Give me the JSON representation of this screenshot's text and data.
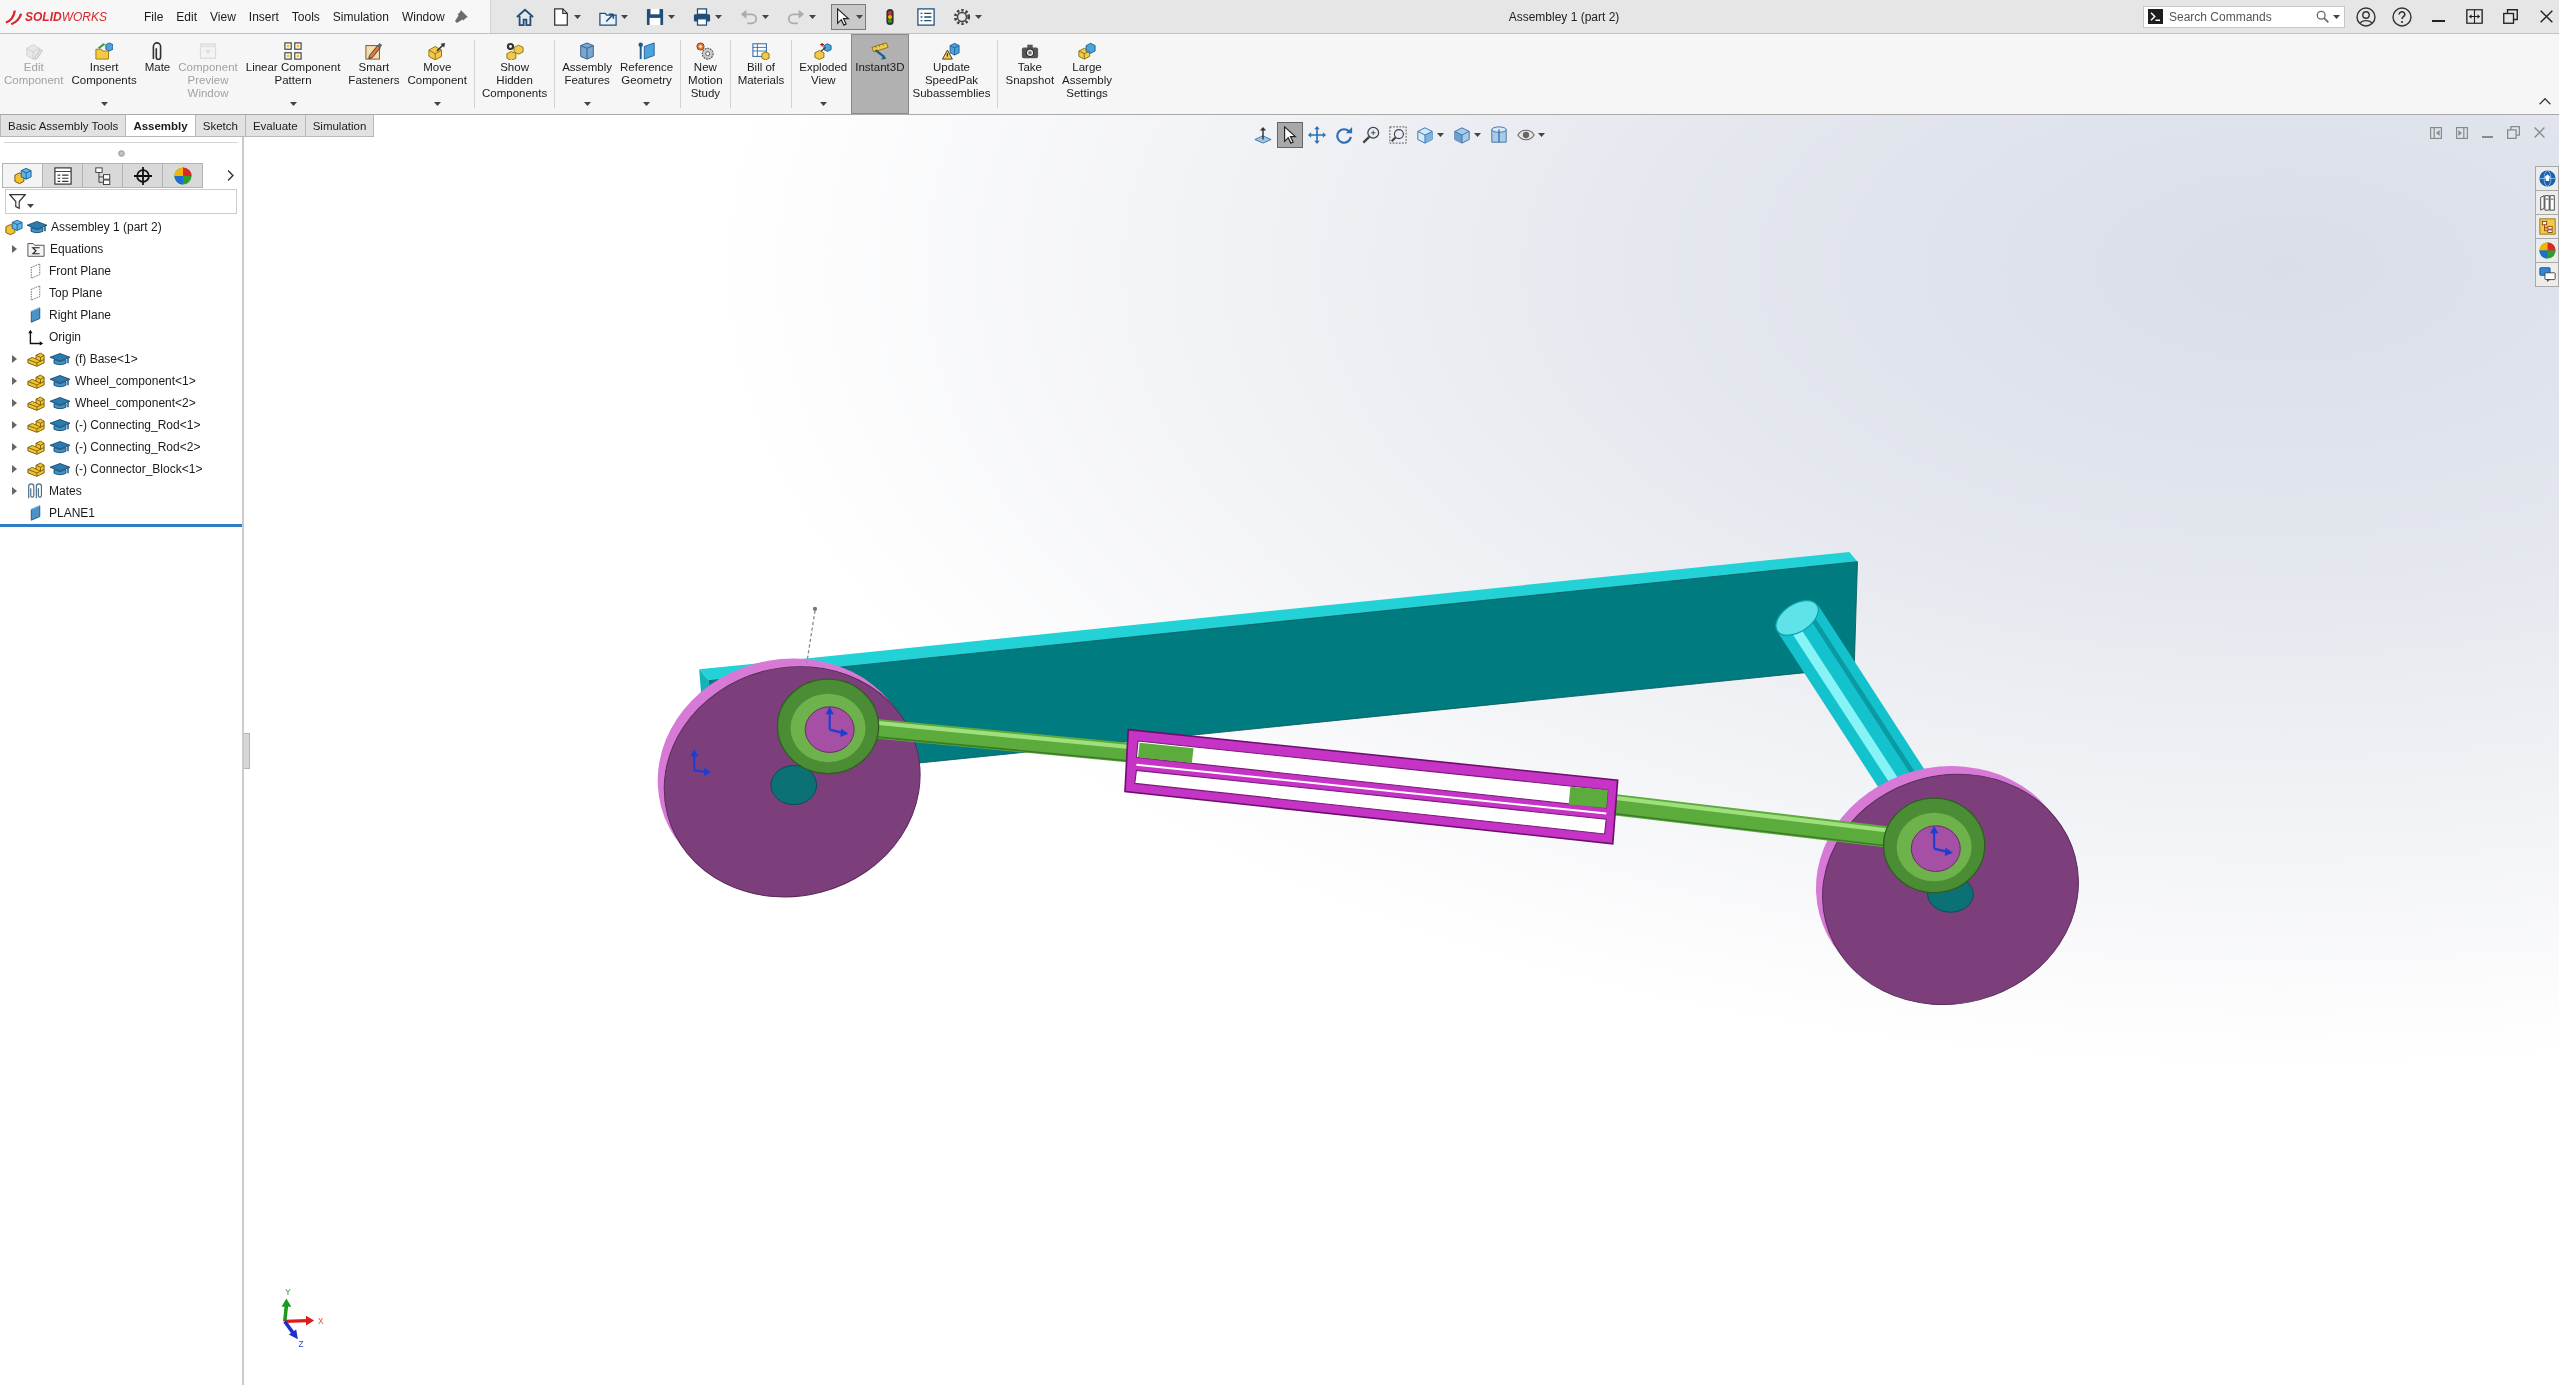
{
  "app": {
    "logo": "**SOLID**WORKS",
    "menus": [
      "File",
      "Edit",
      "View",
      "Insert",
      "Tools",
      "Simulation",
      "Window"
    ],
    "title": "Assembley 1 (part 2)"
  },
  "quick_access": [
    {
      "kind": "home",
      "dropdown": false,
      "disabled": false,
      "selected": false
    },
    {
      "kind": "new",
      "dropdown": true,
      "disabled": false,
      "selected": false
    },
    {
      "kind": "open",
      "dropdown": true,
      "disabled": false,
      "selected": false
    },
    {
      "kind": "save",
      "dropdown": true,
      "disabled": false,
      "selected": false
    },
    {
      "kind": "print",
      "dropdown": true,
      "disabled": false,
      "selected": false
    },
    {
      "kind": "undo",
      "dropdown": true,
      "disabled": true,
      "selected": false
    },
    {
      "kind": "redo",
      "dropdown": true,
      "disabled": true,
      "selected": false
    },
    {
      "kind": "select",
      "dropdown": true,
      "disabled": false,
      "selected": true
    },
    {
      "kind": "rebuild",
      "dropdown": false,
      "disabled": false,
      "selected": false
    },
    {
      "kind": "properties",
      "dropdown": false,
      "disabled": false,
      "selected": false
    },
    {
      "kind": "options",
      "dropdown": true,
      "disabled": false,
      "selected": false
    }
  ],
  "search": {
    "placeholder": "Search Commands"
  },
  "command_manager": {
    "groups": [
      [
        {
          "label": "Edit\nComponent",
          "kind": "edit",
          "disabled": true,
          "selected": false,
          "dropdown": false
        },
        {
          "label": "Insert\nComponents",
          "kind": "insert",
          "disabled": false,
          "selected": false,
          "dropdown": true
        },
        {
          "label": "Mate",
          "kind": "mate",
          "disabled": false,
          "selected": false,
          "dropdown": false
        },
        {
          "label": "Component\nPreview\nWindow",
          "kind": "preview",
          "disabled": true,
          "selected": false,
          "dropdown": false
        },
        {
          "label": "Linear Component\nPattern",
          "kind": "pattern",
          "disabled": false,
          "selected": false,
          "dropdown": true
        },
        {
          "label": "Smart\nFasteners",
          "kind": "fasteners",
          "disabled": false,
          "selected": false,
          "dropdown": false
        },
        {
          "label": "Move\nComponent",
          "kind": "move",
          "disabled": false,
          "selected": false,
          "dropdown": true
        }
      ],
      [
        {
          "label": "Show\nHidden\nComponents",
          "kind": "show",
          "disabled": false,
          "selected": false,
          "dropdown": false
        }
      ],
      [
        {
          "label": "Assembly\nFeatures",
          "kind": "features",
          "disabled": false,
          "selected": false,
          "dropdown": true
        },
        {
          "label": "Reference\nGeometry",
          "kind": "reference",
          "disabled": false,
          "selected": false,
          "dropdown": true
        }
      ],
      [
        {
          "label": "New\nMotion\nStudy",
          "kind": "motion",
          "disabled": false,
          "selected": false,
          "dropdown": false
        }
      ],
      [
        {
          "label": "Bill of\nMaterials",
          "kind": "bom",
          "disabled": false,
          "selected": false,
          "dropdown": false
        }
      ],
      [
        {
          "label": "Exploded\nView",
          "kind": "explode",
          "disabled": false,
          "selected": false,
          "dropdown": true
        },
        {
          "label": "Instant3D",
          "kind": "instant3d",
          "disabled": false,
          "selected": true,
          "dropdown": false
        },
        {
          "label": "Update\nSpeedPak\nSubassemblies",
          "kind": "speedpak",
          "disabled": false,
          "selected": false,
          "dropdown": false
        }
      ],
      [
        {
          "label": "Take\nSnapshot",
          "kind": "snapshot",
          "disabled": false,
          "selected": false,
          "dropdown": false
        },
        {
          "label": "Large\nAssembly\nSettings",
          "kind": "settings",
          "disabled": false,
          "selected": false,
          "dropdown": false
        }
      ]
    ],
    "tabs": [
      {
        "label": "Basic Assembly Tools",
        "selected": false
      },
      {
        "label": "Assembly",
        "selected": true
      },
      {
        "label": "Sketch",
        "selected": false
      },
      {
        "label": "Evaluate",
        "selected": false
      },
      {
        "label": "Simulation",
        "selected": false
      }
    ]
  },
  "feature_tree": {
    "tabs": [
      {
        "kind": "features",
        "selected": true
      },
      {
        "kind": "properties",
        "selected": false
      },
      {
        "kind": "configurations",
        "selected": false
      },
      {
        "kind": "dimxpert",
        "selected": false
      },
      {
        "kind": "display",
        "selected": false
      }
    ],
    "root": {
      "label": "Assembley 1 (part 2)",
      "kind": "assembly",
      "children": [
        {
          "label": "Equations",
          "kind": "equations",
          "expanded": false
        },
        {
          "label": "Front Plane",
          "kind": "plane",
          "shown": false
        },
        {
          "label": "Top Plane",
          "kind": "plane",
          "shown": false
        },
        {
          "label": "Right Plane",
          "kind": "plane",
          "shown": true
        },
        {
          "label": "Origin",
          "kind": "origin"
        },
        {
          "label": "(f) Base<1>",
          "kind": "component",
          "expanded": false
        },
        {
          "label": "Wheel_component<1>",
          "kind": "component",
          "expanded": false
        },
        {
          "label": "Wheel_component<2>",
          "kind": "component",
          "expanded": false
        },
        {
          "label": "(-) Connecting_Rod<1>",
          "kind": "component",
          "expanded": false
        },
        {
          "label": "(-) Connecting_Rod<2>",
          "kind": "component",
          "expanded": false
        },
        {
          "label": "(-) Connector_Block<1>",
          "kind": "component",
          "expanded": false
        },
        {
          "label": "Mates",
          "kind": "mates",
          "expanded": false
        },
        {
          "label": "PLANE1",
          "kind": "plane",
          "shown": true
        }
      ]
    }
  },
  "viewport": {
    "view_tools": [
      {
        "kind": "normal",
        "selected": false,
        "dropdown": false
      },
      {
        "kind": "select",
        "selected": true,
        "dropdown": false
      },
      {
        "kind": "pan",
        "selected": false,
        "dropdown": false
      },
      {
        "kind": "rotate",
        "selected": false,
        "dropdown": false
      },
      {
        "kind": "zoomfit",
        "selected": false,
        "dropdown": false
      },
      {
        "kind": "zoomarea",
        "selected": false,
        "dropdown": false
      },
      {
        "kind": "orientation",
        "selected": false,
        "dropdown": true
      },
      {
        "kind": "display",
        "selected": false,
        "dropdown": true
      },
      {
        "kind": "section",
        "selected": false,
        "dropdown": false
      },
      {
        "kind": "hide",
        "selected": false,
        "dropdown": true
      }
    ],
    "task_pane": [
      {
        "kind": "resources"
      },
      {
        "kind": "library"
      },
      {
        "kind": "explorer"
      },
      {
        "kind": "appearances"
      },
      {
        "kind": "properties"
      }
    ],
    "triad": {
      "x": "X",
      "y": "Y",
      "z": "Z"
    }
  }
}
